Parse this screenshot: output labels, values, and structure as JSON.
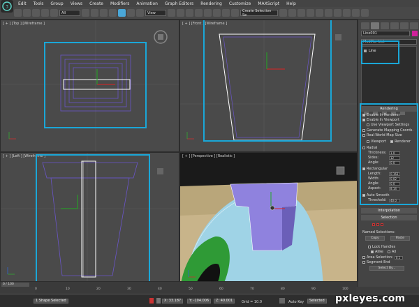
{
  "menu": {
    "items": [
      "Edit",
      "Tools",
      "Group",
      "Views",
      "Create",
      "Modifiers",
      "Animation",
      "Graph Editors",
      "Rendering",
      "Customize",
      "MAXScript",
      "Help"
    ]
  },
  "toolbar": {
    "filter_select": "All",
    "coord_select": "View",
    "selection_set": "Create Selection Se"
  },
  "viewports": {
    "top": "[ + ] [Top ] [Wireframe ]",
    "front": "[ + ] [Front ] [Wireframe ]",
    "left": "[ + ] [Left ] [Wireframe ]",
    "perspective": "[ + ] [Perspective ] [Realistic ]"
  },
  "command_panel": {
    "object_name": "Line001",
    "object_color": "#d0209a",
    "modifier_list": "Modifier List",
    "stack_item": "Line",
    "rendering": {
      "title": "Rendering",
      "enable_renderer": "Enable In Renderer",
      "enable_viewport": "Enable In Viewport",
      "use_viewport_settings": "Use Viewport Settings",
      "generate_mapping": "Generate Mapping Coords.",
      "real_world": "Real-World Map Size",
      "viewport_opt": "Viewport",
      "renderer_opt": "Renderer",
      "radial": "Radial",
      "thickness_label": "Thickness:",
      "thickness_val": "1.0",
      "sides_label": "Sides:",
      "sides_val": "12",
      "angle_label": "Angle:",
      "angle_val": "0.0",
      "rectangular": "Rectangular",
      "length_label": "Length:",
      "length_val": "0.163",
      "width_label": "Width:",
      "width_val": "0.02",
      "angle2_label": "Angle:",
      "angle2_val": "0.0",
      "aspect_label": "Aspect:",
      "aspect_val": "8.14",
      "auto_smooth": "Auto Smooth",
      "threshold_label": "Threshold:",
      "threshold_val": "40.0"
    },
    "interpolation": "Interpolation",
    "selection": {
      "title": "Selection",
      "named_selections": "Named Selections:",
      "copy": "Copy",
      "paste": "Paste",
      "lock_handles": "Lock Handles",
      "alike": "Alike",
      "all": "All",
      "area_selection": "Area Selection:",
      "area_val": "0.1",
      "segment_end": "Segment End",
      "select_by": "Select By..."
    }
  },
  "timeline": {
    "frame": "0 / 100",
    "ticks": [
      "0",
      "10",
      "20",
      "30",
      "40",
      "50",
      "60",
      "70",
      "80",
      "90",
      "100"
    ]
  },
  "status": {
    "selection": "1 Shape Selected",
    "x": "X: 33.187",
    "y": "Y: -104.006",
    "z": "Z: 40.001",
    "grid": "Grid = 10.0",
    "autokey": "Auto Key",
    "autokey_mode": "Selected"
  },
  "watermark": "pxleyes.com"
}
